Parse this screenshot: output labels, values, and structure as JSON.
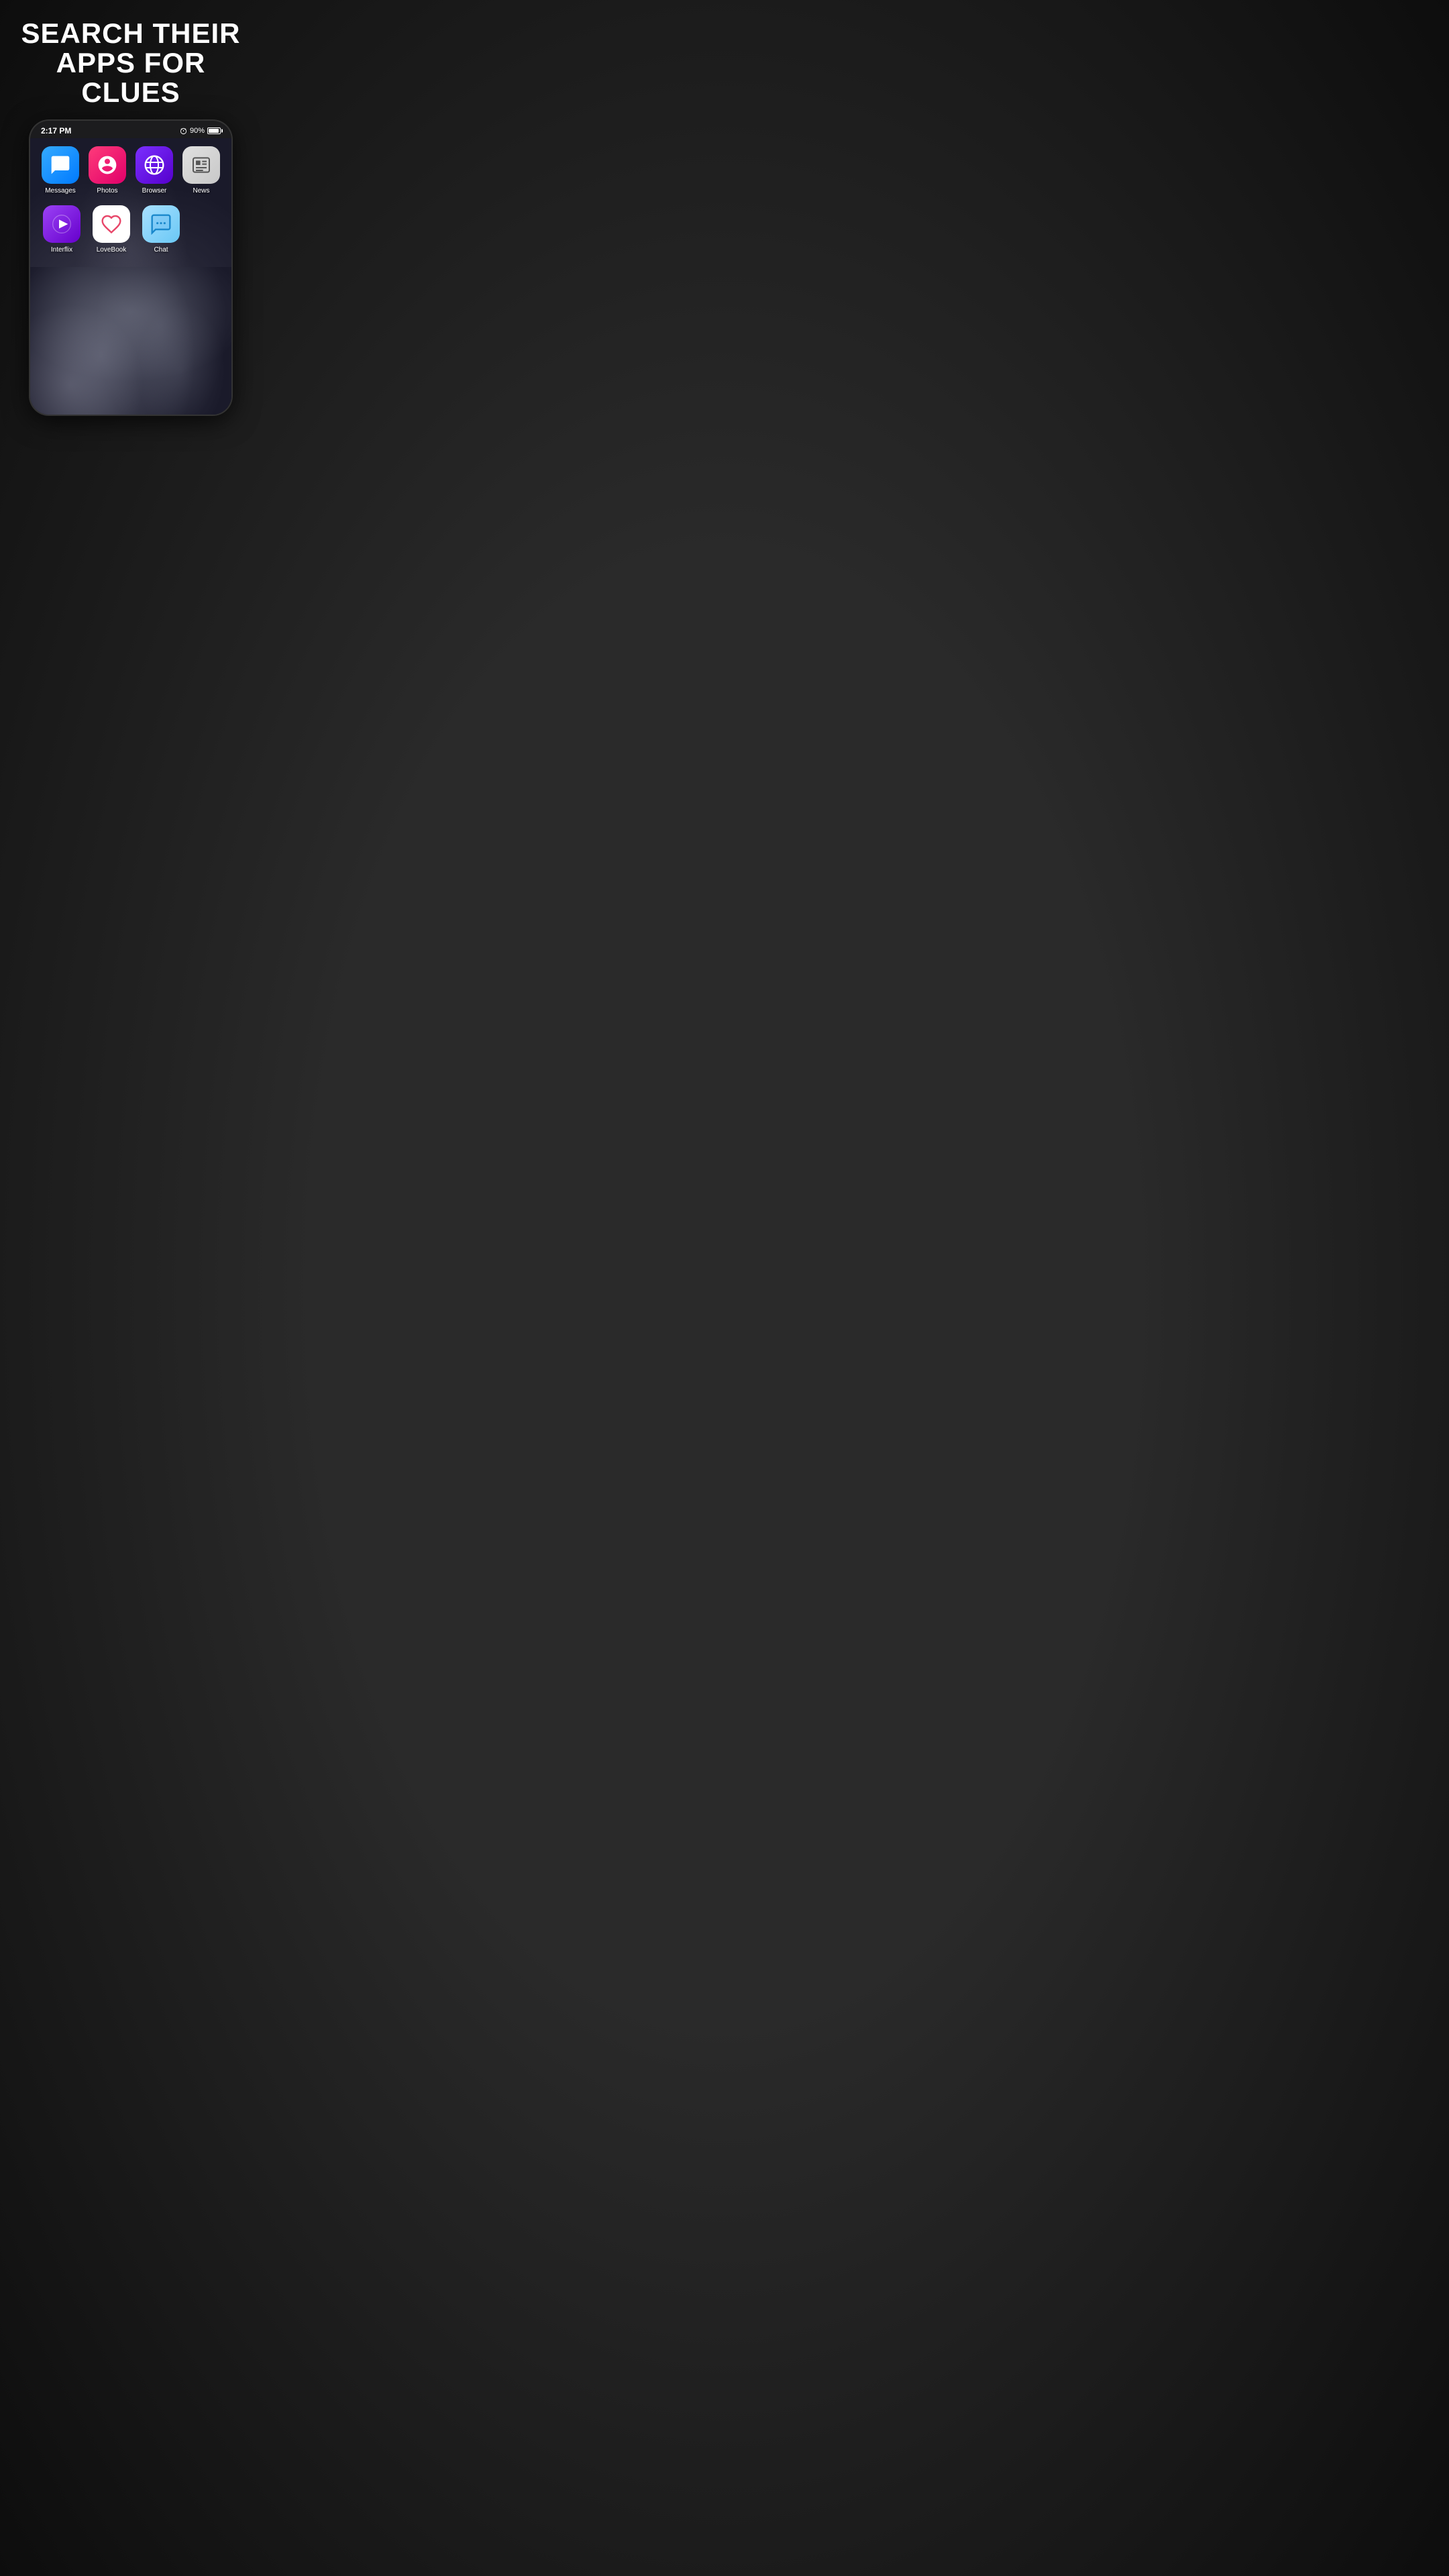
{
  "headline": {
    "line1": "SEARCH THEIR",
    "line2": "APPS FOR CLUES"
  },
  "status_bar": {
    "time": "2:17 PM",
    "battery_percent": "90%"
  },
  "apps": {
    "row1": [
      {
        "id": "messages",
        "label": "Messages",
        "icon_type": "messages"
      },
      {
        "id": "photos",
        "label": "Photos",
        "icon_type": "photos"
      },
      {
        "id": "browser",
        "label": "Browser",
        "icon_type": "browser"
      },
      {
        "id": "news",
        "label": "News",
        "icon_type": "news"
      }
    ],
    "row2": [
      {
        "id": "interflix",
        "label": "Interflix",
        "icon_type": "interflix"
      },
      {
        "id": "lovebook",
        "label": "LoveBook",
        "icon_type": "lovebook"
      },
      {
        "id": "chat",
        "label": "Chat",
        "icon_type": "chat"
      }
    ]
  }
}
